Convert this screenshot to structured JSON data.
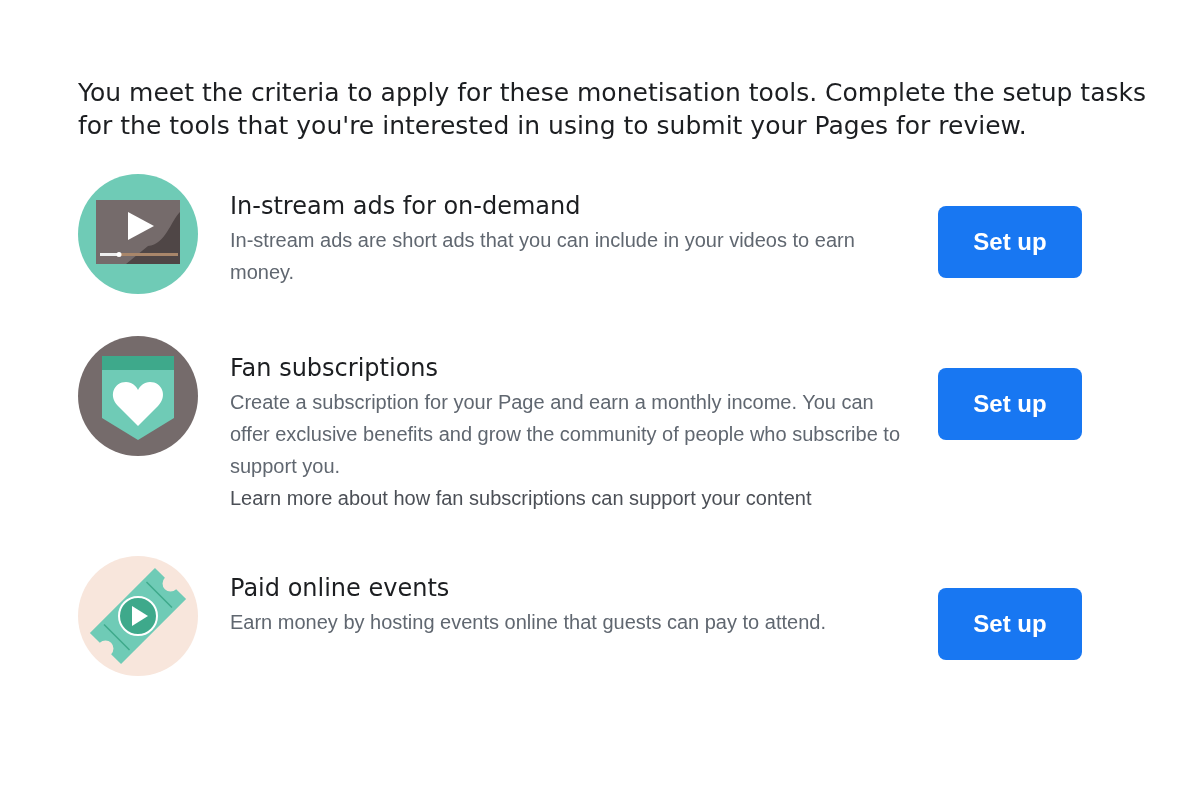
{
  "intro": "You meet the criteria to apply for these monetisation tools. Complete the setup tasks for the tools that you're interested in using to submit your Pages for review.",
  "tools": [
    {
      "kind": "video",
      "title": "In-stream ads for on-demand",
      "description": "In-stream ads are short ads that you can include in your videos to earn money.",
      "button": "Set up"
    },
    {
      "kind": "subscription",
      "title": "Fan subscriptions",
      "description": "Create a subscription for your Page and earn a monthly income. You can offer exclusive benefits and grow the community of people who subscribe to support you.",
      "link": "Learn more about how fan subscriptions can support your content",
      "button": "Set up"
    },
    {
      "kind": "ticket",
      "title": "Paid online events",
      "description": "Earn money by hosting events online that guests can pay to attend.",
      "button": "Set up"
    }
  ]
}
